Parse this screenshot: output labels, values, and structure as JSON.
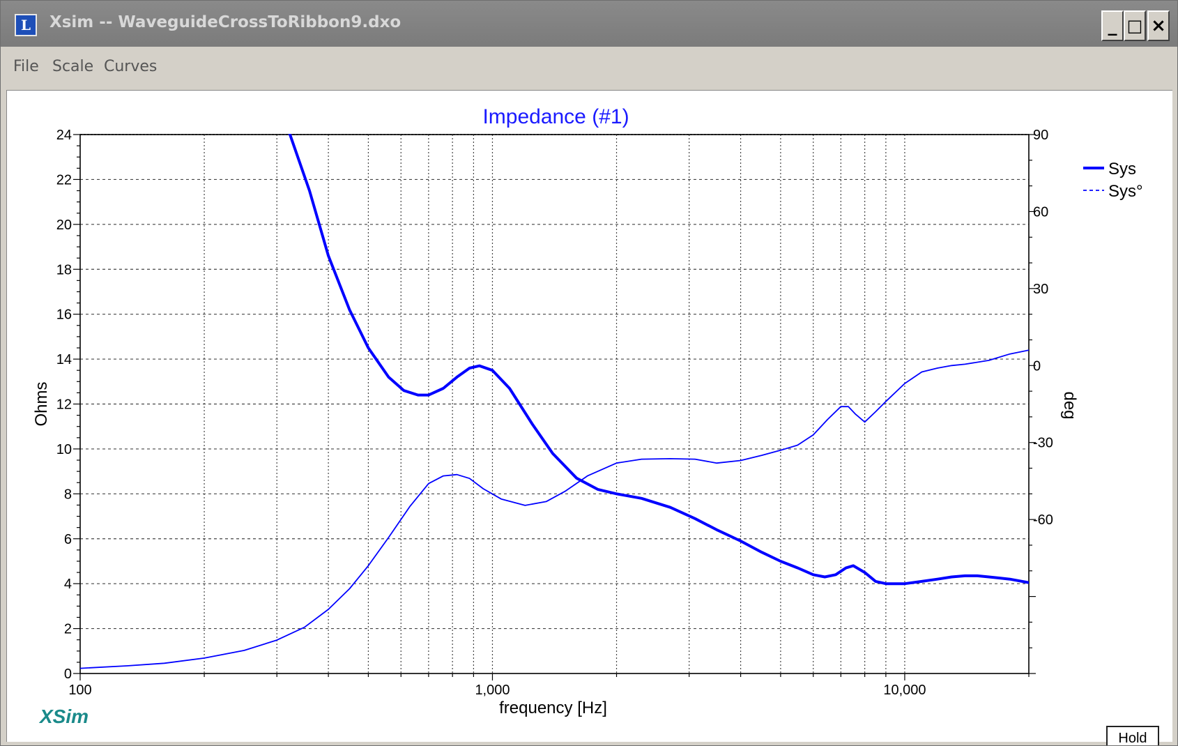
{
  "window": {
    "title": "Xsim -- WaveguideCrossToRibbon9.dxo",
    "icon": "xsim-app-icon",
    "icon_glyph": "L",
    "controls": {
      "minimize": "_",
      "maximize": "□",
      "close": "×"
    }
  },
  "menu": {
    "items": [
      "File",
      "Scale",
      "Curves"
    ]
  },
  "chart_data": {
    "type": "line",
    "title": "Impedance (#1)",
    "xlabel": "frequency [Hz]",
    "ylabel": "Ohms",
    "y2label": "deg",
    "xscale": "log",
    "xlim": [
      100,
      20000
    ],
    "ylim": [
      0,
      24
    ],
    "y2lim": [
      -120,
      90
    ],
    "x_ticks": [
      100,
      1000,
      10000
    ],
    "x_tick_labels": [
      "100",
      "1,000",
      "10,000"
    ],
    "y_ticks": [
      0,
      2,
      4,
      6,
      8,
      10,
      12,
      14,
      16,
      18,
      20,
      22,
      24
    ],
    "y2_ticks": [
      90,
      60,
      30,
      0,
      -30,
      -60
    ],
    "grid": true,
    "legend": "top-right",
    "series": [
      {
        "name": "Sys",
        "axis": "left",
        "style": "solid",
        "color": "#0000ff",
        "x": [
          320,
          360,
          400,
          450,
          500,
          560,
          610,
          660,
          700,
          760,
          820,
          880,
          930,
          1000,
          1100,
          1250,
          1400,
          1600,
          1800,
          2000,
          2300,
          2700,
          3100,
          3500,
          4000,
          4500,
          5000,
          5500,
          6000,
          6400,
          6800,
          7200,
          7500,
          8000,
          8500,
          9000,
          10000,
          11000,
          12000,
          13000,
          14000,
          15000,
          16000,
          17000,
          18000,
          20000
        ],
        "y": [
          24.2,
          21.5,
          18.6,
          16.2,
          14.5,
          13.2,
          12.6,
          12.4,
          12.4,
          12.7,
          13.2,
          13.6,
          13.7,
          13.5,
          12.7,
          11.1,
          9.8,
          8.7,
          8.2,
          8.0,
          7.8,
          7.4,
          6.9,
          6.4,
          5.9,
          5.4,
          5.0,
          4.7,
          4.4,
          4.3,
          4.4,
          4.7,
          4.8,
          4.5,
          4.1,
          4.0,
          4.0,
          4.1,
          4.2,
          4.3,
          4.35,
          4.35,
          4.3,
          4.25,
          4.2,
          4.05
        ]
      },
      {
        "name": "Sys°",
        "axis": "right",
        "style": "dashed",
        "color": "#0000ff",
        "x": [
          100,
          130,
          160,
          200,
          250,
          300,
          350,
          400,
          450,
          500,
          560,
          630,
          700,
          760,
          820,
          880,
          950,
          1050,
          1200,
          1350,
          1500,
          1700,
          2000,
          2300,
          2700,
          3100,
          3500,
          4000,
          4500,
          5000,
          5500,
          6000,
          6500,
          7000,
          7300,
          7600,
          8000,
          8500,
          9000,
          10000,
          11000,
          12000,
          13000,
          14000,
          16000,
          18000,
          20000
        ],
        "y": [
          -118,
          -117,
          -116,
          -114,
          -111,
          -107,
          -102,
          -95,
          -87,
          -78,
          -67,
          -55,
          -46,
          -43,
          -42.5,
          -44,
          -48,
          -52,
          -54.5,
          -53,
          -49,
          -43,
          -38,
          -36.5,
          -36.3,
          -36.5,
          -38,
          -37,
          -35,
          -33,
          -31,
          -27,
          -21,
          -16,
          -16,
          -19,
          -22,
          -18,
          -14,
          -7,
          -2.5,
          -1,
          0,
          0.5,
          2,
          4.5,
          6
        ]
      }
    ]
  },
  "watermark": "XSim",
  "hold_button": "Hold"
}
